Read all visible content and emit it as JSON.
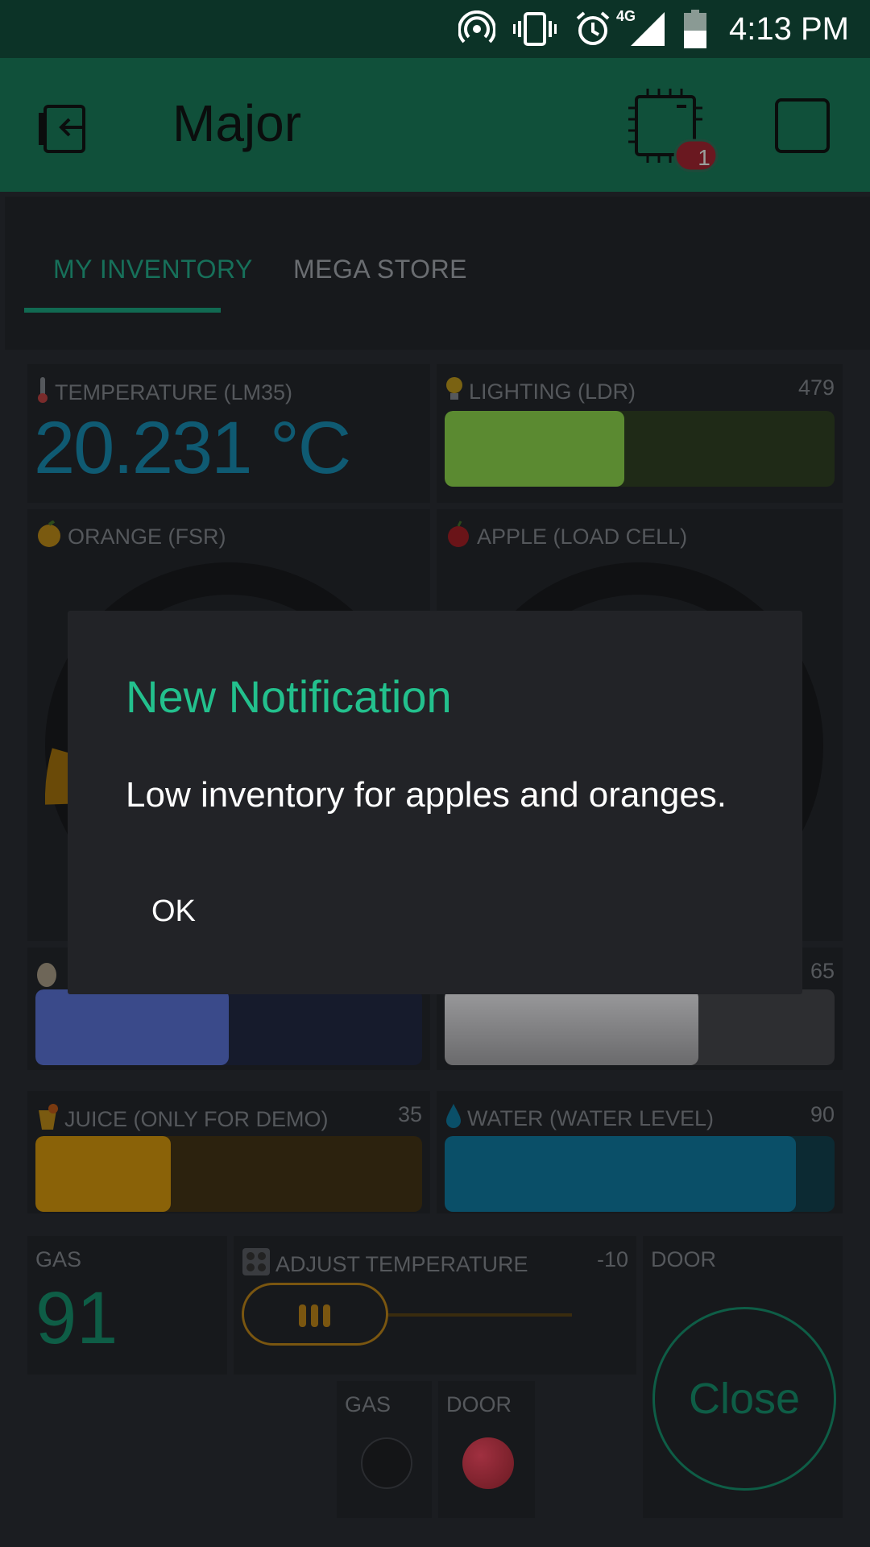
{
  "status_bar": {
    "time": "4:13 PM",
    "network": "4G",
    "icons": [
      "hotspot-icon",
      "vibrate-icon",
      "alarm-icon",
      "signal-icon",
      "battery-icon"
    ]
  },
  "app_bar": {
    "title": "Major",
    "device_badge_count": "1",
    "icons": [
      "back-exit-icon",
      "chip-icon",
      "square-icon"
    ]
  },
  "tabs": [
    {
      "label": "MY INVENTORY",
      "active": true
    },
    {
      "label": "MEGA STORE",
      "active": false
    }
  ],
  "widgets": {
    "temperature": {
      "label": "TEMPERATURE (LM35)",
      "value": "20.231 °C",
      "icon": "thermometer-icon"
    },
    "lighting": {
      "label": "LIGHTING (LDR)",
      "value": "479",
      "level": 0.46,
      "color": "#5b8a31",
      "icon": "bulb-icon"
    },
    "orange": {
      "label": "ORANGE (FSR)",
      "icon": "orange-icon"
    },
    "apple": {
      "label": "APPLE (LOAD CELL)",
      "icon": "apple-icon"
    },
    "egg": {
      "level": 0.5,
      "color": "#3a4a8a",
      "icon": "egg-icon"
    },
    "grey_bar": {
      "value": "65",
      "level": 0.65,
      "color": "#8a8a8c"
    },
    "juice": {
      "label": "JUICE (ONLY FOR DEMO)",
      "value": "35",
      "level": 0.35,
      "color": "#8a6208",
      "icon": "juice-icon"
    },
    "water": {
      "label": "WATER (WATER LEVEL)",
      "value": "90",
      "level": 0.9,
      "color": "#0a4f68",
      "icon": "water-drop-icon"
    },
    "gas": {
      "label": "GAS",
      "value": "91"
    },
    "adjust_temperature": {
      "label": "ADJUST TEMPERATURE",
      "value": "-10",
      "icon": "stove-icon"
    },
    "door": {
      "label": "DOOR",
      "button_label": "Close"
    },
    "gas_led": {
      "label": "GAS"
    },
    "door_led": {
      "label": "DOOR",
      "color": "#7a1d26"
    }
  },
  "dialog": {
    "title": "New Notification",
    "message": "Low inventory for apples and oranges.",
    "ok_label": "OK"
  }
}
